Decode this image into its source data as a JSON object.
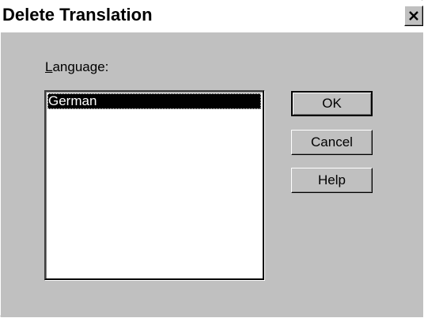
{
  "window": {
    "title": "Delete Translation",
    "close_glyph": "×"
  },
  "form": {
    "language_label_accel": "L",
    "language_label_rest": "anguage:",
    "languages": [
      "German"
    ],
    "selected_index": 0
  },
  "buttons": {
    "ok": "OK",
    "cancel": "Cancel",
    "help": "Help"
  },
  "icons": {
    "close": "close-icon"
  },
  "colors": {
    "face": "#c0c0c0",
    "selection": "#000000",
    "list_bg": "#ffffff"
  }
}
